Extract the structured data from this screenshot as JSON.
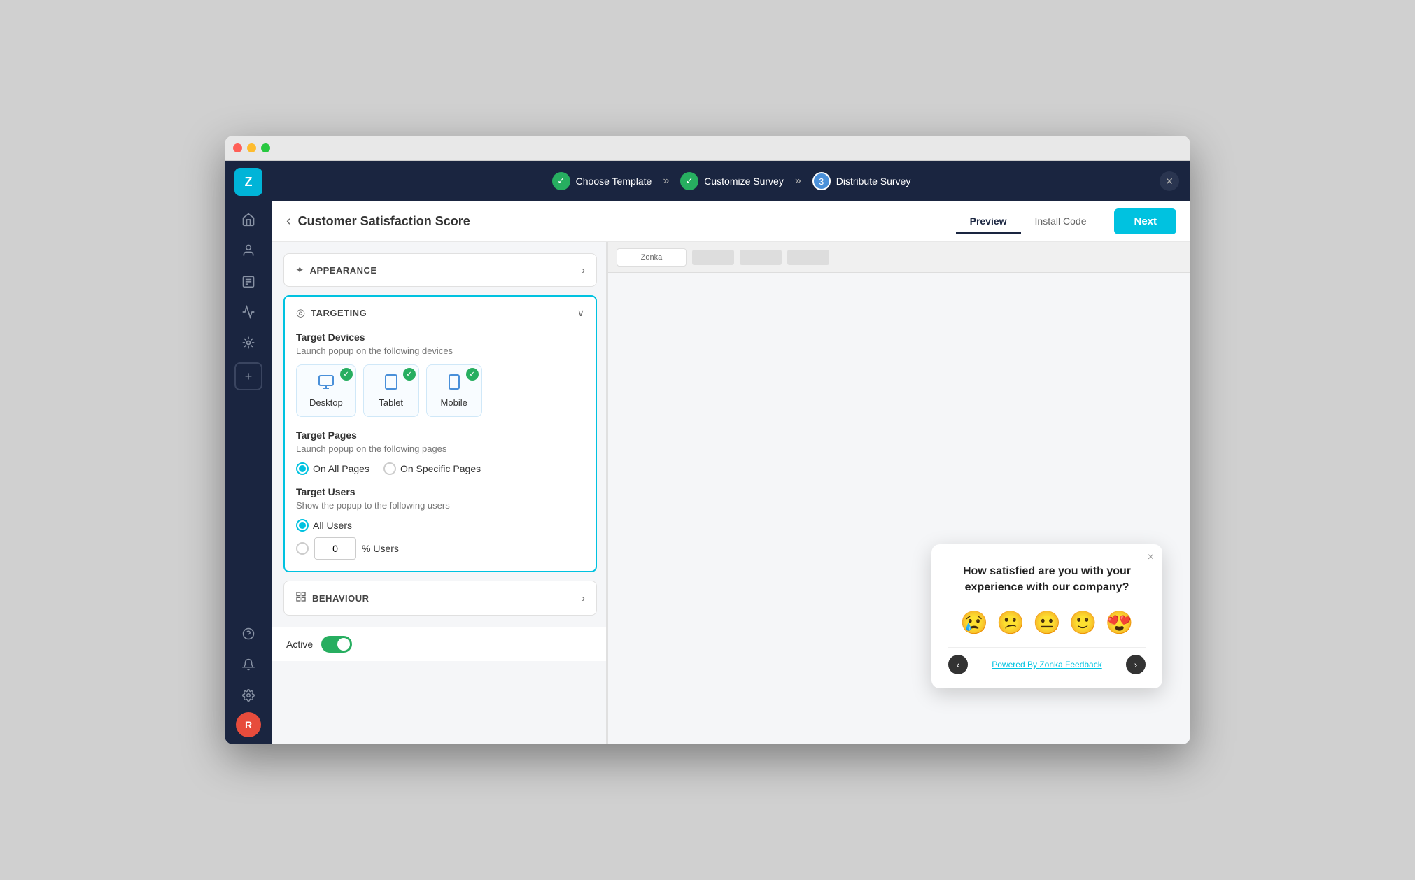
{
  "window": {
    "title": "Zonka Feedback"
  },
  "topnav": {
    "steps": [
      {
        "id": "choose-template",
        "label": "Choose Template",
        "state": "done",
        "icon": "✓"
      },
      {
        "id": "customize-survey",
        "label": "Customize Survey",
        "state": "done",
        "icon": "✓"
      },
      {
        "id": "distribute-survey",
        "label": "Distribute Survey",
        "state": "active",
        "icon": "3"
      }
    ],
    "close_icon": "✕"
  },
  "header": {
    "back_label": "‹",
    "title": "Customer Satisfaction Score",
    "tabs": [
      {
        "id": "preview",
        "label": "Preview",
        "active": true
      },
      {
        "id": "install-code",
        "label": "Install Code",
        "active": false
      }
    ],
    "next_label": "Next"
  },
  "sections": {
    "appearance": {
      "title": "APPEARANCE",
      "icon": "✦",
      "collapsed": true
    },
    "targeting": {
      "title": "TARGETING",
      "icon": "◎",
      "collapsed": false,
      "target_devices": {
        "heading": "Target Devices",
        "desc": "Launch popup on the following devices",
        "devices": [
          {
            "id": "desktop",
            "label": "Desktop",
            "icon": "🖥",
            "checked": true
          },
          {
            "id": "tablet",
            "label": "Tablet",
            "icon": "⬜",
            "checked": true
          },
          {
            "id": "mobile",
            "label": "Mobile",
            "icon": "📱",
            "checked": true
          }
        ]
      },
      "target_pages": {
        "heading": "Target Pages",
        "desc": "Launch popup on the following pages",
        "options": [
          {
            "id": "all-pages",
            "label": "On All Pages",
            "selected": true
          },
          {
            "id": "specific-pages",
            "label": "On Specific Pages",
            "selected": false
          }
        ]
      },
      "target_users": {
        "heading": "Target Users",
        "desc": "Show the popup to the following users",
        "options": [
          {
            "id": "all-users",
            "label": "All Users",
            "selected": true
          },
          {
            "id": "percent-users",
            "label": "% Users",
            "selected": false
          }
        ],
        "percent_value": "0",
        "percent_suffix": "% Users"
      }
    },
    "behaviour": {
      "title": "BEHAVIOUR",
      "icon": "⚙",
      "collapsed": true
    }
  },
  "bottom_bar": {
    "active_label": "Active",
    "toggle_on": true
  },
  "survey_popup": {
    "question": "How satisfied are you with your experience with our company?",
    "emojis": [
      "😢",
      "😕",
      "😐",
      "🙂",
      "😍"
    ],
    "powered_by_text": "Powered By ",
    "powered_by_link": "Zonka Feedback",
    "prev_icon": "‹",
    "next_icon": "›",
    "close_icon": "×"
  },
  "sidebar": {
    "logo": "Z",
    "items": [
      {
        "id": "home",
        "icon": "⌂"
      },
      {
        "id": "contacts",
        "icon": "👤"
      },
      {
        "id": "users",
        "icon": "👥"
      },
      {
        "id": "surveys",
        "icon": "📋"
      },
      {
        "id": "analytics",
        "icon": "📊"
      }
    ],
    "add_icon": "+",
    "bottom": [
      {
        "id": "help",
        "icon": "?"
      },
      {
        "id": "notifications",
        "icon": "🔔"
      },
      {
        "id": "settings",
        "icon": "⚙"
      }
    ],
    "avatar_label": "R"
  }
}
